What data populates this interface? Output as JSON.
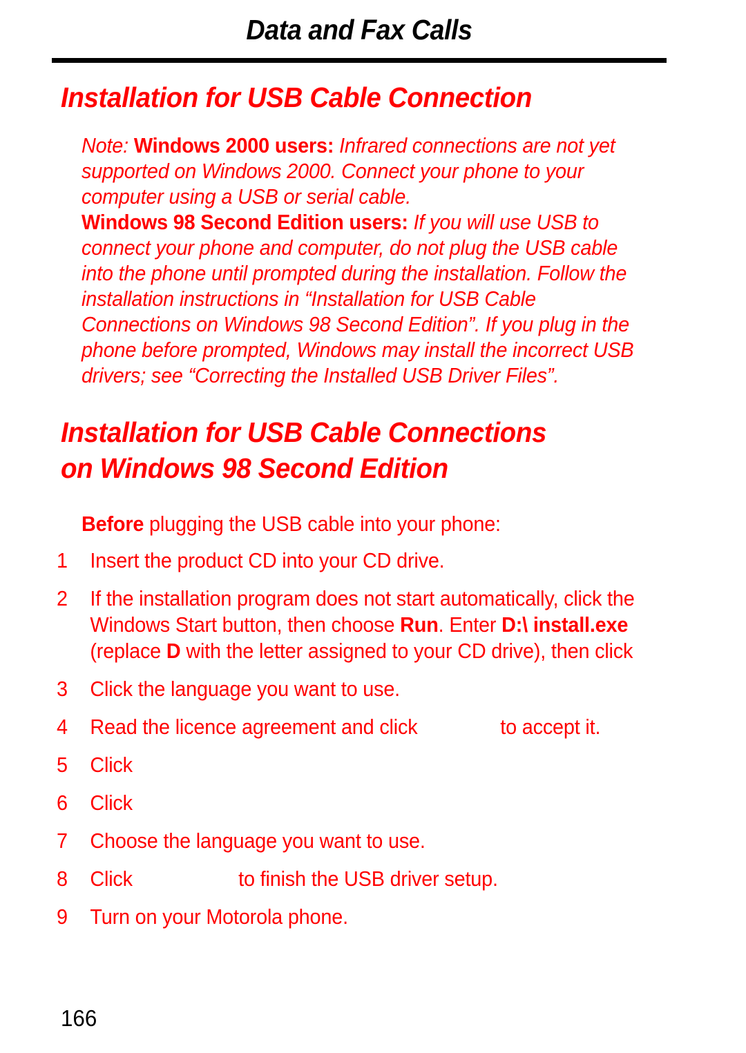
{
  "page": {
    "running_head": "Data and Fax Calls",
    "folio": "166",
    "accent_color": "#ff0000",
    "text_color": "#ff0000",
    "head_color": "#000000",
    "background": "#ffffff"
  },
  "headings": {
    "section_1": "Installation for USB Cable Connection",
    "section_2_line_1": "Installation for USB Cable Connections",
    "section_2_line_2": "on Windows 98 Second Edition"
  },
  "note": {
    "lead": "Note:",
    "bold_1": "Windows 2000 users:",
    "body_1": " Infrared connections are not yet supported on Windows 2000. Connect your phone to your computer using a USB or serial cable.",
    "bold_2": "Windows 98 Second Edition users:",
    "body_2": " If you will use USB to connect your phone and computer, do not plug the USB cable into the phone until prompted during the installation. Follow the installation instructions in “Installation for USB Cable Connections on Windows 98 Second Edition”. If you plug in the phone before prompted, Windows may install the incorrect USB drivers; see “Correcting the Installed USB Driver Files”."
  },
  "intro": {
    "bold": "Before",
    "rest": " plugging the USB cable into your phone:"
  },
  "steps": [
    {
      "num": "1",
      "parts": [
        {
          "text": "Insert the product CD into your CD drive.",
          "bold": false
        }
      ]
    },
    {
      "num": "2",
      "parts": [
        {
          "text": "If the installation program does not start automatically, click the Windows Start button, then choose ",
          "bold": false
        },
        {
          "text": "Run",
          "bold": true
        },
        {
          "text": ". Enter ",
          "bold": false
        },
        {
          "text": "D:\\",
          "bold": true
        },
        {
          "text": " ",
          "bold": false
        },
        {
          "text": "install.exe",
          "bold": true
        },
        {
          "text": " (replace ",
          "bold": false
        },
        {
          "text": "D",
          "bold": true
        },
        {
          "text": " with the letter assigned to your CD drive), then click ",
          "bold": false
        }
      ]
    },
    {
      "num": "3",
      "parts": [
        {
          "text": "Click the language you want to use.",
          "bold": false
        }
      ]
    },
    {
      "num": "4",
      "parts": [
        {
          "text": "Read the licence agreement and click ",
          "bold": false
        },
        {
          "gap": "sm"
        },
        {
          "text": " to accept it.",
          "bold": false
        }
      ]
    },
    {
      "num": "5",
      "parts": [
        {
          "text": "Click ",
          "bold": false
        }
      ]
    },
    {
      "num": "6",
      "parts": [
        {
          "text": "Click ",
          "bold": false
        }
      ]
    },
    {
      "num": "7",
      "parts": [
        {
          "text": "Choose the language you want to use.",
          "bold": false
        }
      ]
    },
    {
      "num": "8",
      "parts": [
        {
          "text": "Click ",
          "bold": false
        },
        {
          "gap": "md"
        },
        {
          "text": " to finish the USB driver setup.",
          "bold": false
        }
      ]
    },
    {
      "num": "9",
      "parts": [
        {
          "text": "Turn on your Motorola phone.",
          "bold": false
        }
      ]
    }
  ]
}
